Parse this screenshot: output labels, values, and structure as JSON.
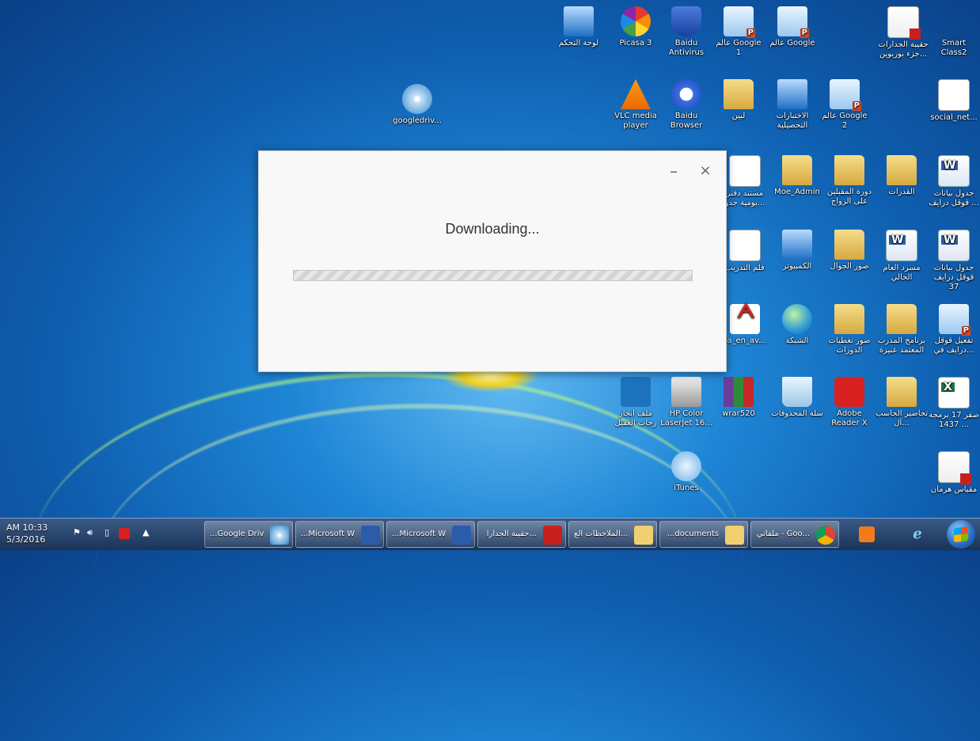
{
  "desktop_icons": [
    {
      "label": "Smart Class2",
      "icon": "folder-icon"
    },
    {
      "label": "حقيبة الجدارات ...جزء بوربوين",
      "icon": "pdf-icon"
    },
    {
      "label": "عالم Google",
      "icon": "powerpoint-icon"
    },
    {
      "label": "عالم Google 1",
      "icon": "powerpoint-icon"
    },
    {
      "label": "Baidu Antivirus",
      "icon": "shield-icon"
    },
    {
      "label": "Picasa 3",
      "icon": "picasa-icon"
    },
    {
      "label": "لوحة التحكم",
      "icon": "control-panel-icon"
    },
    {
      "label": "social_net...",
      "icon": "document-icon"
    },
    {
      "label": "عالم Google 2",
      "icon": "powerpoint-icon"
    },
    {
      "label": "الاختبارات التحصيلية",
      "icon": "document-icon"
    },
    {
      "label": "لبين",
      "icon": "folder-icon"
    },
    {
      "label": "Baidu Browser",
      "icon": "baidu-icon"
    },
    {
      "label": "VLC media player",
      "icon": "vlc-icon"
    },
    {
      "label": "googledriv...",
      "icon": "cd-icon"
    },
    {
      "label": "جدول بيانات قوقل درايف ...",
      "icon": "word-icon"
    },
    {
      "label": "القدرات",
      "icon": "folder-icon"
    },
    {
      "label": "دورة المقبلين على الزواج",
      "icon": "folder-icon"
    },
    {
      "label": "Moe_Admin",
      "icon": "user-folder-icon"
    },
    {
      "label": "مستند دفتر يومية جدو...",
      "icon": "document-icon"
    },
    {
      "label": "جدول بيانات قوقل درايف 37",
      "icon": "word-icon"
    },
    {
      "label": "مسرد العام الحالي",
      "icon": "word-icon"
    },
    {
      "label": "صور الجوال",
      "icon": "folder-icon"
    },
    {
      "label": "الكمبيوتر",
      "icon": "computer-icon"
    },
    {
      "label": "فلم التدريب",
      "icon": "video-icon"
    },
    {
      "label": "تفعيل قوقل درايف في...",
      "icon": "powerpoint-icon"
    },
    {
      "label": "برنامج المدرب المعتمد عنيزة",
      "icon": "folder-icon"
    },
    {
      "label": "صور تغطيات الدورات",
      "icon": "folder-icon"
    },
    {
      "label": "الشبكة",
      "icon": "network-icon"
    },
    {
      "label": "ra_en_av...",
      "icon": "avira-icon"
    },
    {
      "label": "صفر 17 برمجة 1437 ...",
      "icon": "excel-icon"
    },
    {
      "label": "تحاضير الحاسب آل...",
      "icon": "folder-icon"
    },
    {
      "label": "Adobe Reader X",
      "icon": "adobe-icon"
    },
    {
      "label": "سلة المحذوفات",
      "icon": "recycle-bin-icon"
    },
    {
      "label": "wrar520",
      "icon": "winrar-icon"
    },
    {
      "label": "HP Color LaserJet 16...",
      "icon": "printer-icon"
    },
    {
      "label": "ملف انجاز رحاب العقيل",
      "icon": "tile-icon"
    },
    {
      "label": "iTunes",
      "icon": "itunes-icon"
    },
    {
      "label": "مقياس هرمان",
      "icon": "pdf-icon"
    }
  ],
  "dialog": {
    "status": "Downloading...",
    "minimize_label": "–",
    "close_label": "×",
    "progress_fraction": 0
  },
  "taskbar": {
    "clock_time": "AM 10:33",
    "clock_date": "5/3/2016",
    "items": [
      {
        "label": "...Google Driv",
        "icon": "cd-icon"
      },
      {
        "label": "...Microsoft W",
        "icon": "word-icon"
      },
      {
        "label": "...Microsoft W",
        "icon": "word-icon"
      },
      {
        "label": "حقيبة الجدارا...",
        "icon": "pdf-icon"
      },
      {
        "label": "الملاحظات الع...",
        "icon": "folder-icon"
      },
      {
        "label": "...documents",
        "icon": "folder-icon"
      },
      {
        "label": "ملفاتي - Goo...",
        "icon": "chrome-icon"
      }
    ],
    "pinned": [
      {
        "icon": "media-player-icon"
      },
      {
        "icon": "internet-explorer-icon"
      }
    ]
  }
}
